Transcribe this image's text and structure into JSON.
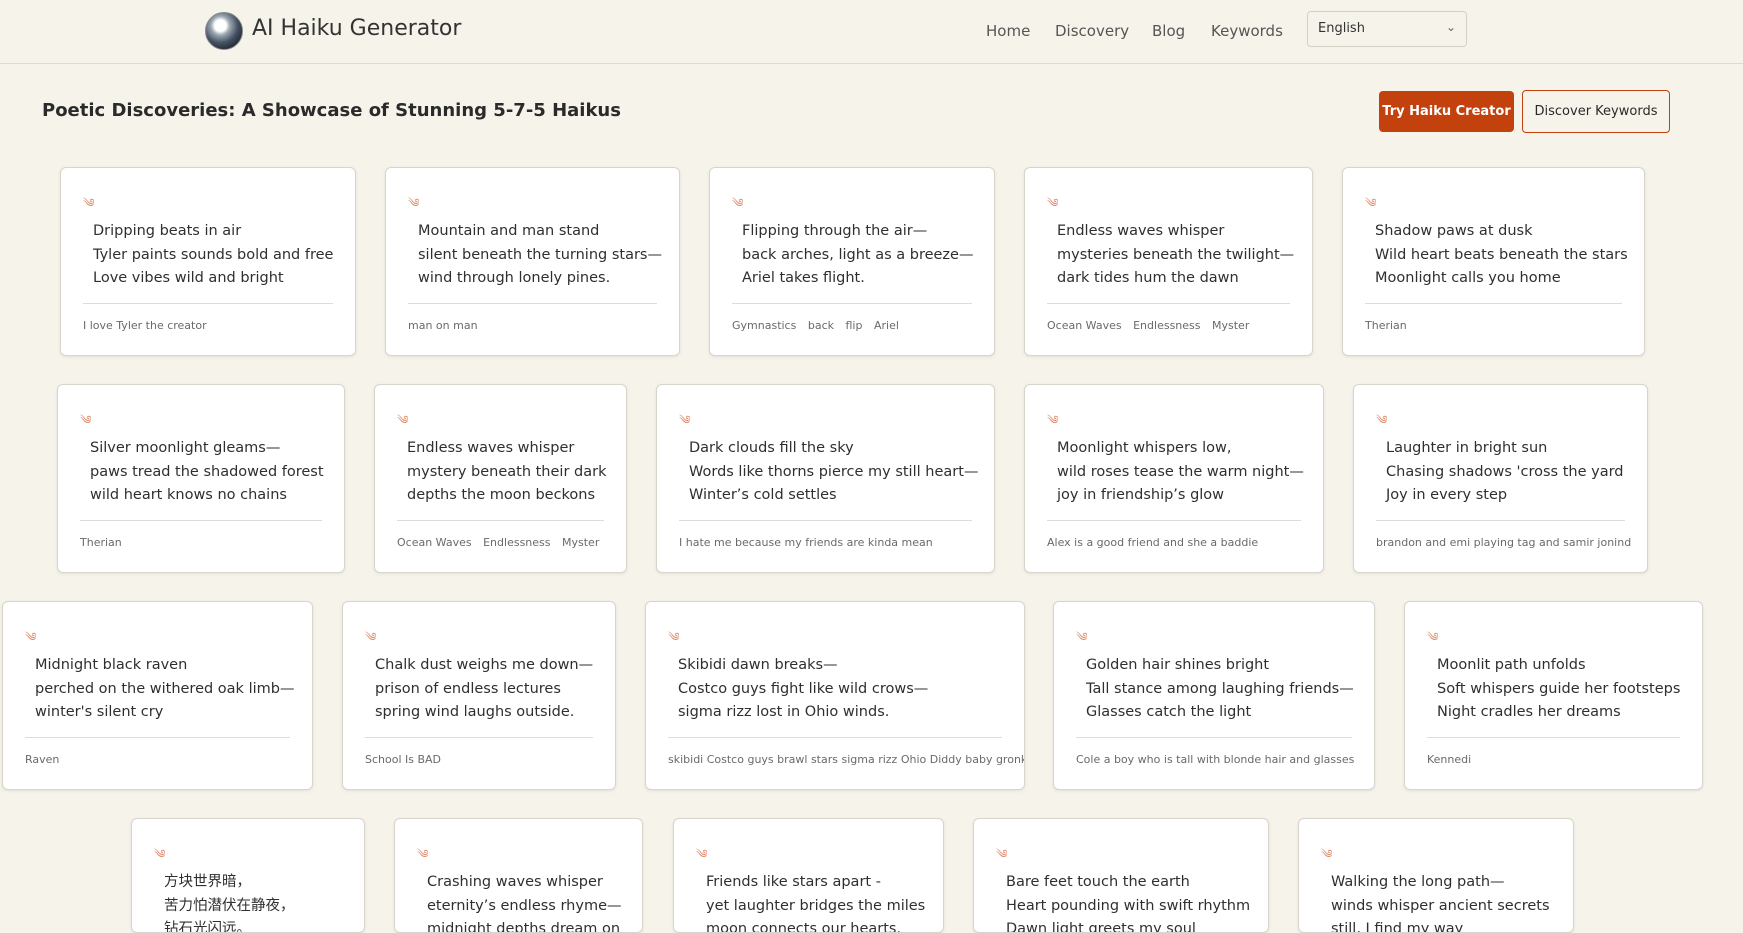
{
  "header": {
    "brand": "AI Haiku Generator",
    "nav": [
      "Home",
      "Discovery",
      "Blog",
      "Keywords"
    ],
    "language": "English"
  },
  "main": {
    "title": "Poetic Discoveries: A Showcase of Stunning 5-7-5 Haikus",
    "try_button": "Try Haiku Creator",
    "discover_button": "Discover Keywords"
  },
  "cards": [
    {
      "lines": [
        "Dripping beats in air",
        "Tyler paints sounds bold and free",
        "Love vibes wild and bright"
      ],
      "tags": [
        "I love Tyler the creator"
      ]
    },
    {
      "lines": [
        "Mountain and man stand",
        "silent beneath the turning stars—",
        "wind through lonely pines."
      ],
      "tags": [
        "man on man"
      ]
    },
    {
      "lines": [
        "Flipping through the air—",
        "back arches, light as a breeze—",
        "Ariel takes flight."
      ],
      "tags": [
        "Gymnastics",
        "back",
        "flip",
        "Ariel"
      ]
    },
    {
      "lines": [
        "Endless waves whisper",
        "mysteries beneath the twilight—",
        "dark tides hum the dawn"
      ],
      "tags": [
        "Ocean Waves",
        "Endlessness",
        "Myster"
      ]
    },
    {
      "lines": [
        "Shadow paws at dusk",
        "Wild heart beats beneath the stars",
        "Moonlight calls you home"
      ],
      "tags": [
        "Therian"
      ]
    },
    {
      "lines": [
        "Silver moonlight gleams—",
        "paws tread the shadowed forest",
        "wild heart knows no chains"
      ],
      "tags": [
        "Therian"
      ]
    },
    {
      "lines": [
        "Endless waves whisper",
        "mystery beneath their dark",
        "depths the moon beckons"
      ],
      "tags": [
        "Ocean Waves",
        "Endlessness",
        "Myster"
      ]
    },
    {
      "lines": [
        "Dark clouds fill the sky",
        "Words like thorns pierce my still heart—",
        "Winter’s cold settles"
      ],
      "tags": [
        "I hate me because my friends are kinda mean"
      ]
    },
    {
      "lines": [
        "Moonlight whispers low,",
        "wild roses tease the warm night—",
        "joy in friendship’s glow"
      ],
      "tags": [
        "Alex is a good friend and she a baddie"
      ]
    },
    {
      "lines": [
        "Laughter in bright sun",
        "Chasing shadows 'cross the yard",
        "Joy in every step"
      ],
      "tags": [
        "brandon and emi playing tag and samir jonind"
      ]
    },
    {
      "lines": [
        "Midnight black raven",
        "perched on the withered oak limb—",
        "winter's silent cry"
      ],
      "tags": [
        "Raven"
      ]
    },
    {
      "lines": [
        "Chalk dust weighs me down—",
        "prison of endless lectures",
        "spring wind laughs outside."
      ],
      "tags": [
        "School Is BAD"
      ]
    },
    {
      "lines": [
        "Skibidi dawn breaks—",
        "Costco guys fight like wild crows—",
        "sigma rizz lost in Ohio winds."
      ],
      "tags": [
        "skibidi Costco guys brawl stars sigma rizz Ohio Diddy baby gronk"
      ]
    },
    {
      "lines": [
        "Golden hair shines bright",
        "Tall stance among laughing friends—",
        "Glasses catch the light"
      ],
      "tags": [
        "Cole a boy who is tall with blonde hair and glasses"
      ]
    },
    {
      "lines": [
        "Moonlit path unfolds",
        "Soft whispers guide her footsteps",
        "Night cradles her dreams"
      ],
      "tags": [
        "Kennedi"
      ]
    },
    {
      "lines": [
        "方块世界暗，",
        "苦力怕潜伏在静夜，",
        "钻石光闪远。"
      ],
      "tags": []
    },
    {
      "lines": [
        "Crashing waves whisper",
        "eternity’s endless rhyme—",
        "midnight depths dream on"
      ],
      "tags": []
    },
    {
      "lines": [
        "Friends like stars apart -",
        "yet laughter bridges the miles",
        "moon connects our hearts."
      ],
      "tags": []
    },
    {
      "lines": [
        "Bare feet touch the earth",
        "Heart pounding with swift rhythm",
        "Dawn light greets my soul"
      ],
      "tags": []
    },
    {
      "lines": [
        "Walking the long path—",
        "winds whisper ancient secrets",
        "still, I find my way"
      ],
      "tags": []
    }
  ]
}
